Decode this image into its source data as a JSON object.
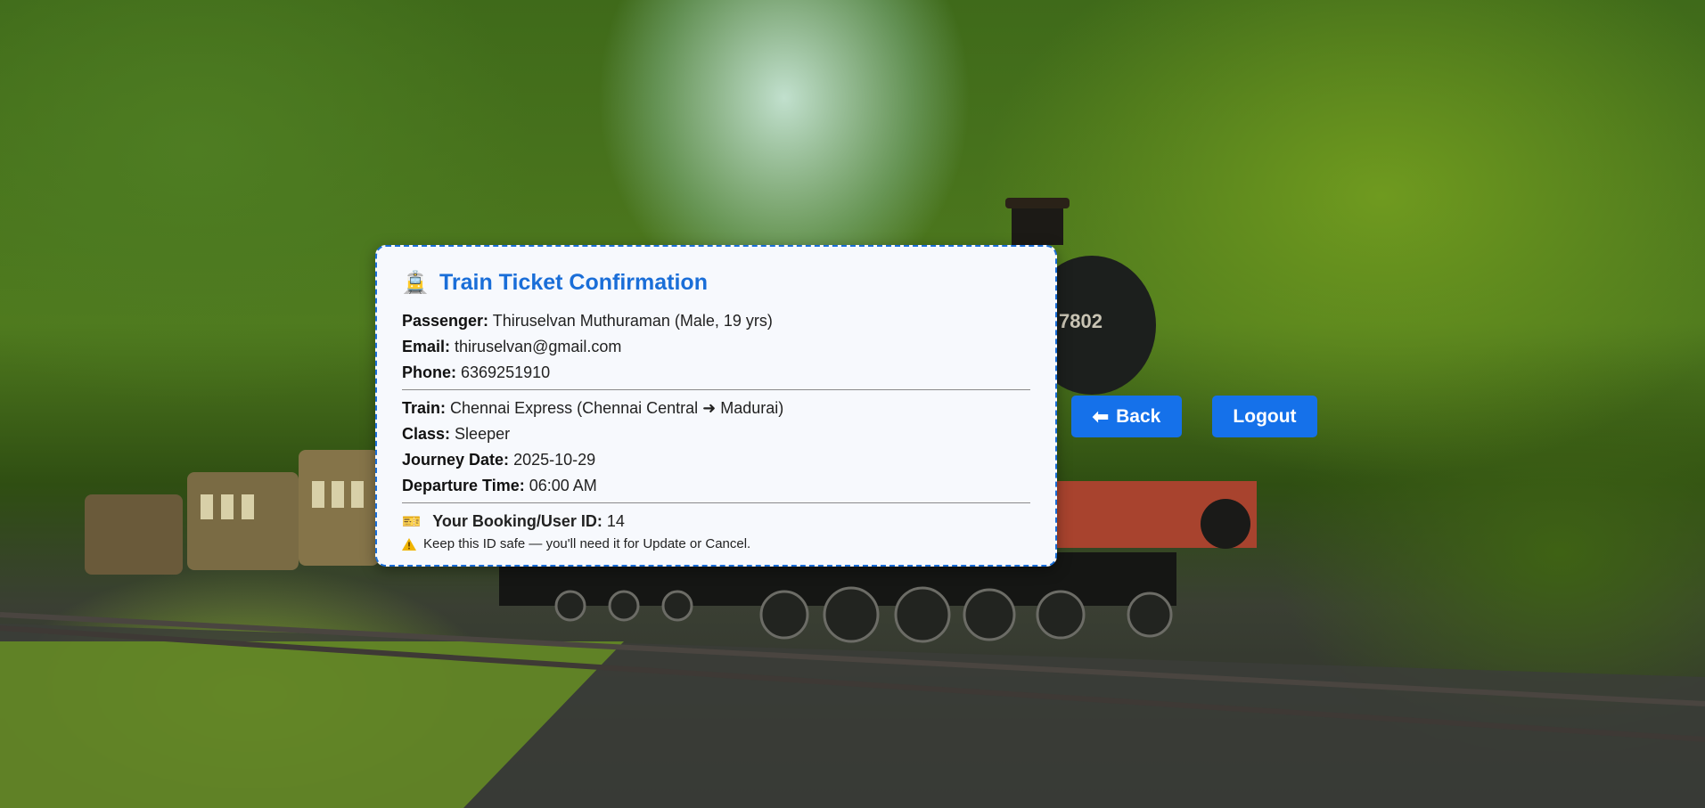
{
  "ticket": {
    "title_icon": "🚊",
    "title": "Train Ticket Confirmation",
    "passenger_label": "Passenger:",
    "passenger_value": "Thiruselvan Muthuraman (Male, 19 yrs)",
    "email_label": "Email:",
    "email_value": "thiruselvan@gmail.com",
    "phone_label": "Phone:",
    "phone_value": "6369251910",
    "train_label": "Train:",
    "train_value": "Chennai Express (Chennai Central ➜ Madurai)",
    "class_label": "Class:",
    "class_value": "Sleeper",
    "date_label": "Journey Date:",
    "date_value": "2025-10-29",
    "time_label": "Departure Time:",
    "time_value": "06:00 AM",
    "booking_icon": "🎫",
    "booking_label": "Your Booking/User ID:",
    "booking_value": "14",
    "note_icon": "warning-icon",
    "note": "Keep this ID safe — you'll need it for Update or Cancel."
  },
  "nav": {
    "back_arrow": "⬅",
    "back_label": "Back",
    "logout_label": "Logout"
  },
  "colors": {
    "accent": "#1a6ed8",
    "button": "#1571ea",
    "card_bg": "#f7f9fd"
  },
  "background": {
    "scene": "forest-steam-train-photo",
    "locomotive_number": "7802"
  }
}
